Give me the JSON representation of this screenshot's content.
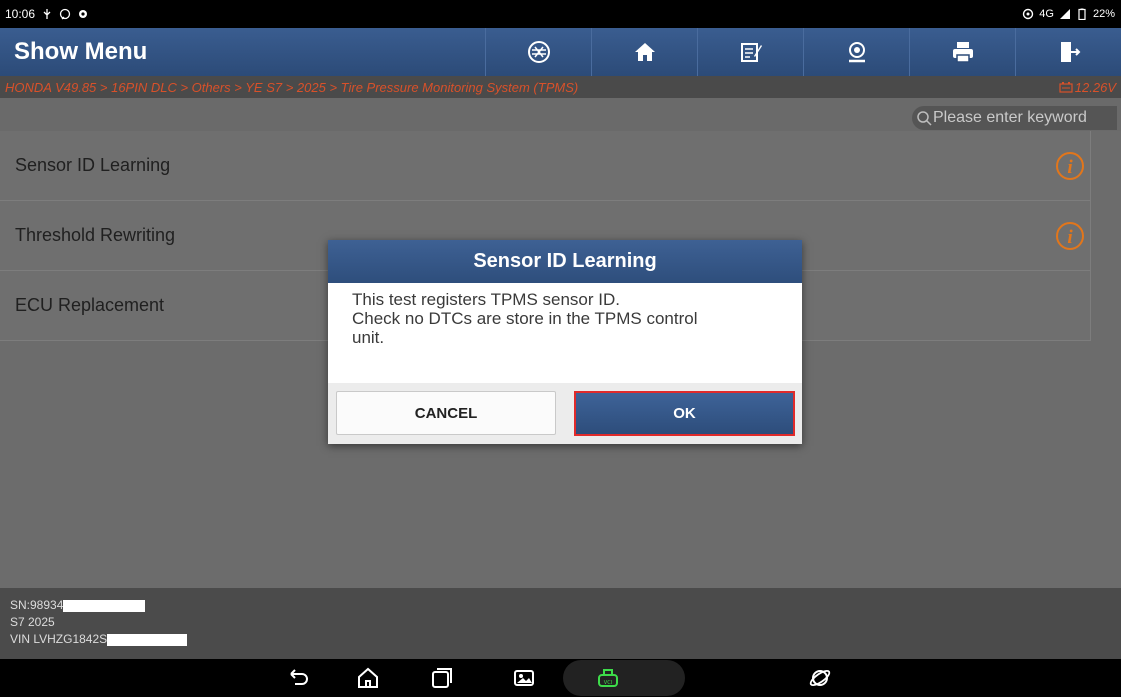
{
  "status_bar": {
    "time": "10:06",
    "network": "4G",
    "battery": "22%"
  },
  "header": {
    "title": "Show Menu",
    "tools": [
      {
        "name": "diagnose-icon"
      },
      {
        "name": "home-icon"
      },
      {
        "name": "report-icon"
      },
      {
        "name": "remote-support-icon"
      },
      {
        "name": "print-icon"
      },
      {
        "name": "exit-icon"
      }
    ]
  },
  "breadcrumb": {
    "path": "HONDA V49.85 > 16PIN DLC > Others > YE S7 > 2025 > Tire Pressure Monitoring System (TPMS)",
    "voltage": "12.26V"
  },
  "search": {
    "placeholder": "Please enter keyword"
  },
  "menu": {
    "items": [
      {
        "label": "Sensor ID Learning"
      },
      {
        "label": "Threshold Rewriting"
      },
      {
        "label": "ECU Replacement"
      }
    ]
  },
  "footer": {
    "sn": "SN:98934",
    "vehicle": "S7 2025",
    "vin": "VIN LVHZG1842S"
  },
  "dialog": {
    "title": "Sensor ID Learning",
    "message_line1": "This test registers TPMS sensor ID.",
    "message_line2": "Check no DTCs are store in the TPMS control",
    "message_line3": "unit.",
    "cancel_label": "CANCEL",
    "ok_label": "OK"
  },
  "colors": {
    "header_blue": "#2c4b78",
    "breadcrumb_text": "#d8512a",
    "info_icon": "#e2761b",
    "ok_border": "#e02b2b",
    "vci_green": "#3ddc4a"
  }
}
